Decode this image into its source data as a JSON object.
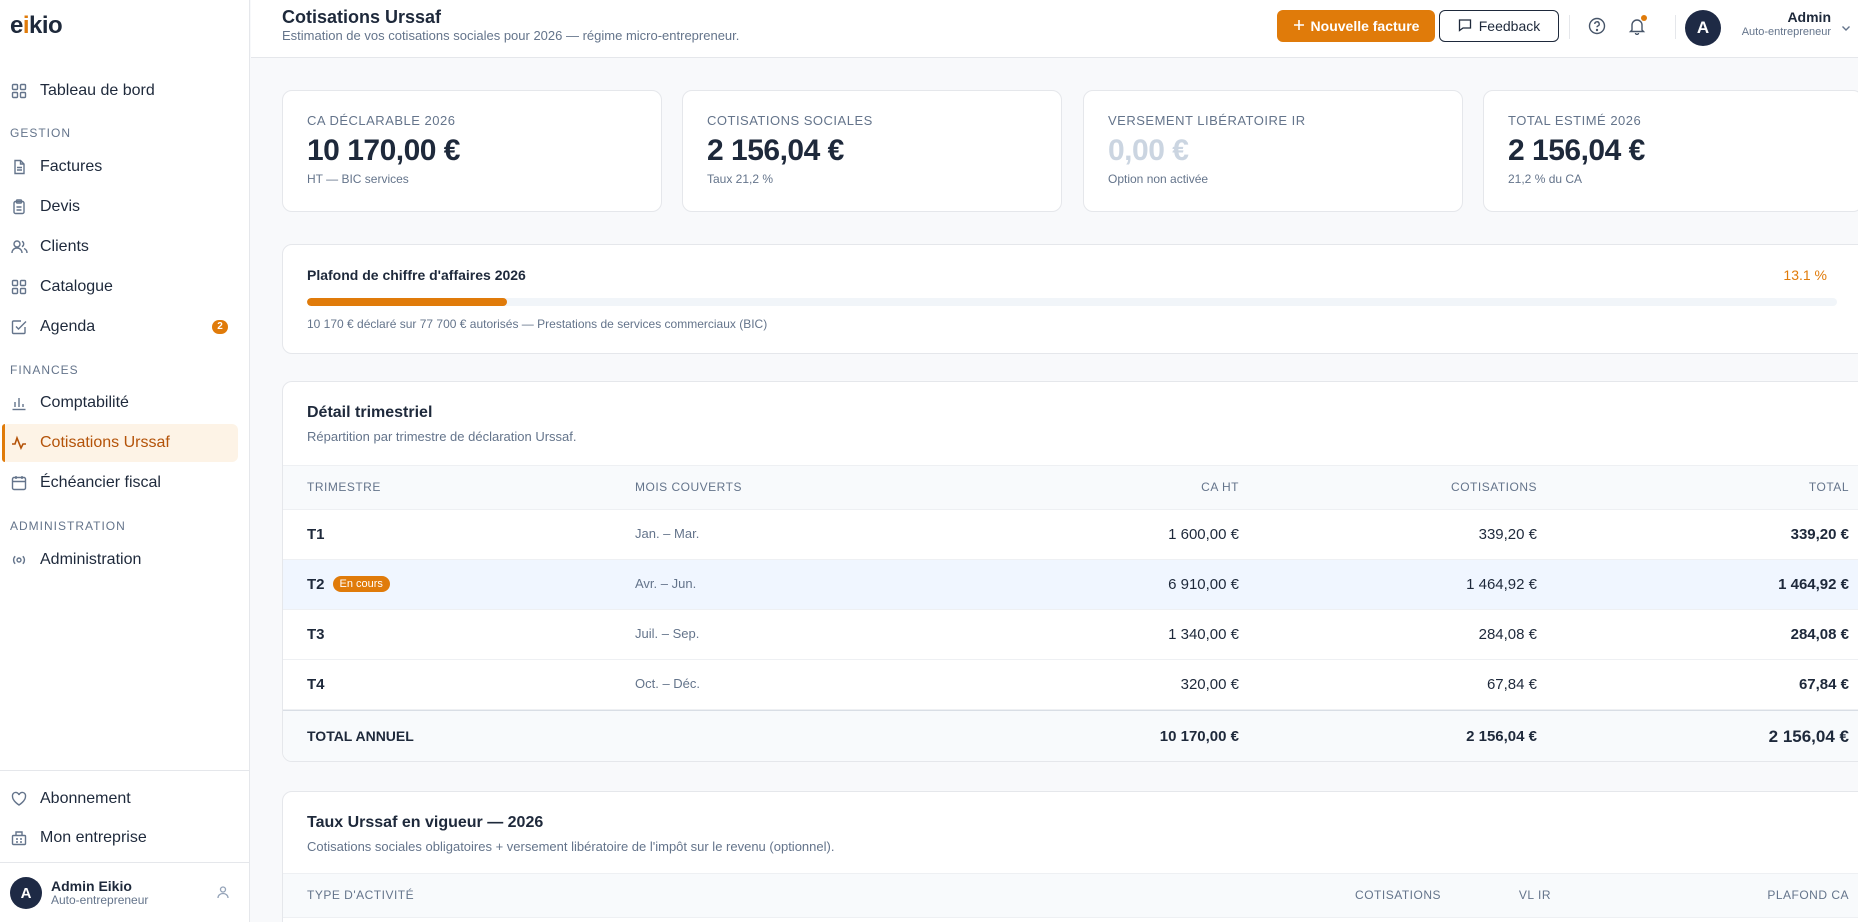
{
  "logo": {
    "prefix": "e",
    "dot": "i",
    "suffix": "kio"
  },
  "sidebar": {
    "top_item": {
      "label": "Tableau de bord",
      "icon": "grid-icon"
    },
    "sections": [
      {
        "title": "GESTION"
      },
      {
        "title": "FINANCES"
      },
      {
        "title": "ADMINISTRATION"
      }
    ],
    "gestion": [
      {
        "label": "Factures",
        "icon": "document-icon"
      },
      {
        "label": "Devis",
        "icon": "clipboard-icon"
      },
      {
        "label": "Clients",
        "icon": "users-icon"
      },
      {
        "label": "Catalogue",
        "icon": "grid-icon"
      },
      {
        "label": "Agenda",
        "icon": "check-square-icon",
        "badge": "2"
      }
    ],
    "finances": [
      {
        "label": "Comptabilité",
        "icon": "bar-chart-icon"
      },
      {
        "label": "Cotisations Urssaf",
        "icon": "activity-icon",
        "active": true
      },
      {
        "label": "Échéancier fiscal",
        "icon": "calendar-icon"
      }
    ],
    "administration": [
      {
        "label": "Administration",
        "icon": "broadcast-icon"
      }
    ],
    "bottom": [
      {
        "label": "Abonnement",
        "icon": "heart-icon"
      },
      {
        "label": "Mon entreprise",
        "icon": "building-icon"
      }
    ],
    "user": {
      "initial": "A",
      "name": "Admin Eikio",
      "role": "Auto-entrepreneur"
    }
  },
  "header": {
    "title": "Cotisations Urssaf",
    "subtitle": "Estimation de vos cotisations sociales pour 2026 — régime micro-entrepreneur.",
    "primary_button": "Nouvelle facture",
    "feedback_button": "Feedback",
    "user": {
      "initial": "A",
      "name": "Admin",
      "role": "Auto-entrepreneur"
    }
  },
  "stats": [
    {
      "label": "CA DÉCLARABLE 2026",
      "value": "10 170,00 €",
      "note": "HT — BIC services",
      "muted": false
    },
    {
      "label": "COTISATIONS SOCIALES",
      "value": "2 156,04 €",
      "note": "Taux 21,2 %",
      "muted": false
    },
    {
      "label": "VERSEMENT LIBÉRATOIRE IR",
      "value": "0,00 €",
      "note": "Option non activée",
      "muted": true
    },
    {
      "label": "TOTAL ESTIMÉ 2026",
      "value": "2 156,04 €",
      "note": "21,2 % du CA",
      "muted": false
    }
  ],
  "plafond": {
    "title": "Plafond de chiffre d'affaires 2026",
    "percent_label": "13.1 %",
    "progress": 0.131,
    "note": "10 170 € déclaré sur 77 700 € autorisés — Prestations de services commerciaux (BIC)"
  },
  "quarterly": {
    "title": "Détail trimestriel",
    "subtitle": "Répartition par trimestre de déclaration Urssaf.",
    "columns": [
      "TRIMESTRE",
      "MOIS COUVERTS",
      "CA HT",
      "COTISATIONS",
      "TOTAL"
    ],
    "rows": [
      {
        "quarter": "T1",
        "months": "Jan. – Mar.",
        "ca": "1 600,00 €",
        "cotisations": "339,20 €",
        "total": "339,20 €"
      },
      {
        "quarter": "T2",
        "badge": "En cours",
        "months": "Avr. – Jun.",
        "ca": "6 910,00 €",
        "cotisations": "1 464,92 €",
        "total": "1 464,92 €"
      },
      {
        "quarter": "T3",
        "months": "Juil. – Sep.",
        "ca": "1 340,00 €",
        "cotisations": "284,08 €",
        "total": "284,08 €"
      },
      {
        "quarter": "T4",
        "months": "Oct. – Déc.",
        "ca": "320,00 €",
        "cotisations": "67,84 €",
        "total": "67,84 €"
      }
    ],
    "total": {
      "label": "TOTAL ANNUEL",
      "ca": "10 170,00 €",
      "cotisations": "2 156,04 €",
      "total": "2 156,04 €"
    }
  },
  "rates": {
    "title": "Taux Urssaf en vigueur — 2026",
    "subtitle": "Cotisations sociales obligatoires + versement libératoire de l'impôt sur le revenu (optionnel).",
    "columns": [
      "TYPE D'ACTIVITÉ",
      "COTISATIONS",
      "VL IR",
      "PLAFOND CA"
    ]
  },
  "colors": {
    "accent": "#e07b0a",
    "navy": "#1e2a45",
    "active_bg": "#fdf3e6",
    "highlight_row": "#f0f6ff"
  }
}
